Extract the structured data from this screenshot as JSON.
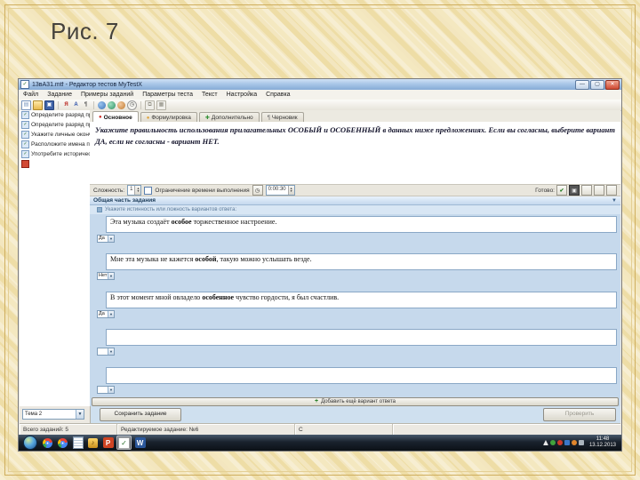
{
  "slide": {
    "caption": "Рис. 7"
  },
  "window": {
    "title": "13вА31.mtf - Редактор тестов MyTestX",
    "controls": {
      "minimize": "—",
      "maximize": "▢",
      "close": "✕"
    },
    "menu": [
      "Файл",
      "Задание",
      "Примеры заданий",
      "Параметры теста",
      "Текст",
      "Настройка",
      "Справка"
    ],
    "toolbar_icons": [
      "new-file-icon",
      "open-folder-icon",
      "save-icon",
      "spellcheck-icon",
      "font-icon",
      "paragraph-icon",
      "globe-blue-icon",
      "globe-green-icon",
      "globe-orange-icon",
      "clock-icon",
      "copy-icon",
      "paste-icon"
    ]
  },
  "sidebar": {
    "items": [
      {
        "label": "Определите разряд при…"
      },
      {
        "label": "Определите разряд при…"
      },
      {
        "label": "Укажите личные оконча…"
      },
      {
        "label": "Расположите имена при…"
      },
      {
        "label": "Употребите исторически…"
      },
      {
        "label": ""
      }
    ],
    "bottom_combo": "Тема 2"
  },
  "editor": {
    "tabs": [
      {
        "label": "Основное"
      },
      {
        "label": "Формулировка"
      },
      {
        "label": "Дополнительно"
      },
      {
        "label": "Черновик"
      }
    ],
    "question": "Укажите правильность использования прилагательных ОСОБЫЙ и ОСОБЕННЫЙ в данных ниже предложениях. Если вы согласны, выберите вариант ДА, если не согласны - вариант НЕТ.",
    "params": {
      "difficulty_label": "Сложность:",
      "difficulty_value": "1",
      "time_label": "Ограничение времени выполнения",
      "time_value": "0:00:30",
      "ready_label": "Готово:"
    },
    "section": {
      "header": "Общая часть задания",
      "instruction": "Укажите истинность или ложность вариантов ответа:"
    },
    "answers": [
      {
        "pre": "Эта музыка создаёт ",
        "bold": "особое",
        "post": " торжественное настроение.",
        "value": "Да"
      },
      {
        "pre": "Мне эта музыка не кажется ",
        "bold": "особой",
        "post": ", такую можно услышать везде.",
        "value": "Нет"
      },
      {
        "pre": "В этот момент мной овладело ",
        "bold": "особенное",
        "post": " чувство гордости, я был счастлив.",
        "value": "Да"
      },
      {
        "pre": "",
        "bold": "",
        "post": "",
        "value": ""
      },
      {
        "pre": "",
        "bold": "",
        "post": "",
        "value": ""
      }
    ],
    "add_answer_label": "Добавить ещё вариант ответа",
    "save_button": "Сохранить задание",
    "check_button": "Проверить"
  },
  "statusbar": {
    "total": "Всего заданий: 5",
    "editing": "Редактируемое задание: №6",
    "drive": "С"
  },
  "taskbar": {
    "icons": [
      "start-orb",
      "chrome-icon",
      "chrome-icon",
      "notepad-icon",
      "reminder-icon",
      "powerpoint-icon",
      "mytest-icon",
      "word-icon"
    ],
    "clock_time": "11:48",
    "clock_date": "13.12.2013"
  }
}
